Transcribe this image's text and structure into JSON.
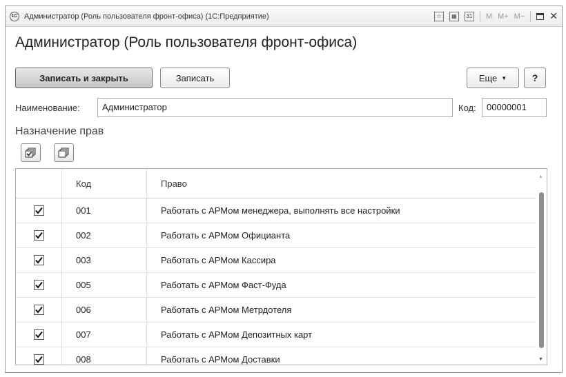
{
  "window": {
    "title": "Администратор (Роль пользователя фронт-офиса) (1С:Предприятие)",
    "logo": "1C",
    "m_buttons": [
      "M",
      "M+",
      "M−"
    ]
  },
  "form": {
    "title": "Администратор (Роль пользователя фронт-офиса)",
    "toolbar": {
      "save_close_label": "Записать и закрыть",
      "save_label": "Записать",
      "more_label": "Еще",
      "help_label": "?"
    },
    "name_label": "Наименование:",
    "name_value": "Администратор",
    "code_label": "Код:",
    "code_value": "00000001",
    "rights_section_title": "Назначение прав"
  },
  "table": {
    "columns": [
      "Код",
      "Право"
    ],
    "rows": [
      {
        "checked": true,
        "code": "001",
        "right": "Работать с АРМом менеджера, выполнять все настройки"
      },
      {
        "checked": true,
        "code": "002",
        "right": "Работать с АРМом Официанта"
      },
      {
        "checked": true,
        "code": "003",
        "right": "Работать с АРМом Кассира"
      },
      {
        "checked": true,
        "code": "005",
        "right": "Работать с АРМом Фаст-Фуда"
      },
      {
        "checked": true,
        "code": "006",
        "right": "Работать с АРМом Метрдотеля"
      },
      {
        "checked": true,
        "code": "007",
        "right": "Работать с АРМом Депозитных карт"
      },
      {
        "checked": true,
        "code": "008",
        "right": "Работать с АРМом Доставки"
      }
    ]
  }
}
